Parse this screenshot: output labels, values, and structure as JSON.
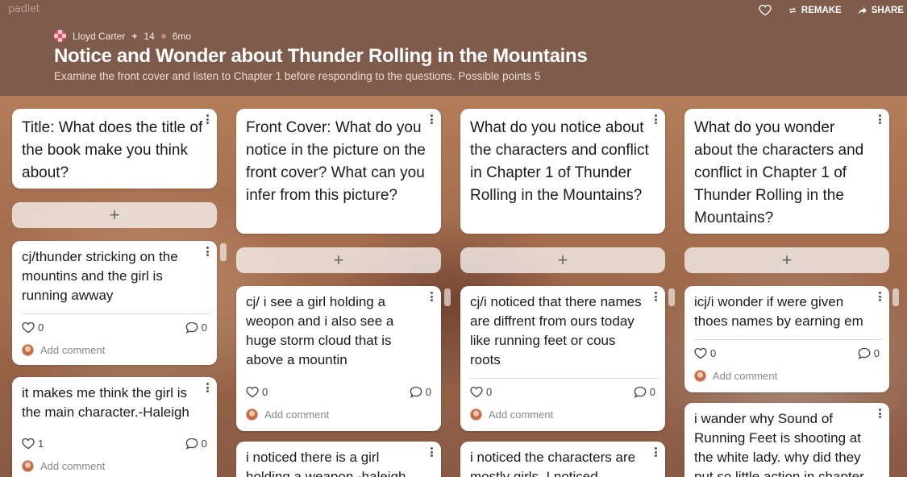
{
  "app": {
    "brand": "padlet"
  },
  "toolbar": {
    "remake_label": "REMAKE",
    "share_label": "SHARE"
  },
  "board": {
    "author": "Lloyd Carter",
    "collaborators": "14",
    "age": "6mo",
    "title": "Notice and Wonder about Thunder Rolling in the Mountains",
    "subtitle": "Examine the front cover and listen to Chapter 1 before responding to the questions. Possible points 5"
  },
  "add_label": "+",
  "comment_placeholder": "Add comment",
  "columns": [
    {
      "title": "Title: What does the title of the book make you think about?",
      "posts": [
        {
          "text": "cj/thunder stricking on the mountins and the girl is running awway",
          "likes": "0",
          "comments": "0"
        },
        {
          "text": "it makes me think the girl is the main character.-Haleigh",
          "likes": "1",
          "comments": "0"
        }
      ]
    },
    {
      "title": "Front Cover: What do you notice in the picture on the front cover? What can you infer from this picture?",
      "posts": [
        {
          "text": "cj/ i see a girl holding a weopon and i also see a huge storm cloud that is above a mountin",
          "likes": "0",
          "comments": "0"
        },
        {
          "text": "i noticed there is a girl holding a weapon.-haleigh"
        }
      ]
    },
    {
      "title": "What do you notice about the characters and conflict in Chapter 1 of Thunder Rolling in the Mountains?",
      "posts": [
        {
          "text": "cj/i noticed that there names are diffrent from ours today like running feet or cous roots",
          "likes": "0",
          "comments": "0"
        },
        {
          "text": "i noticed the characters are mostly girls. I noticed"
        }
      ]
    },
    {
      "title": "What do you wonder about the characters and conflict in Chapter 1 of Thunder Rolling in the Mountains?",
      "posts": [
        {
          "text": "icj/i wonder if were given thoes names by earning em",
          "likes": "0",
          "comments": "0"
        },
        {
          "text": "i wander why Sound of Running Feet is shooting at the white lady. why did they put so little action in chapter"
        }
      ]
    }
  ]
}
